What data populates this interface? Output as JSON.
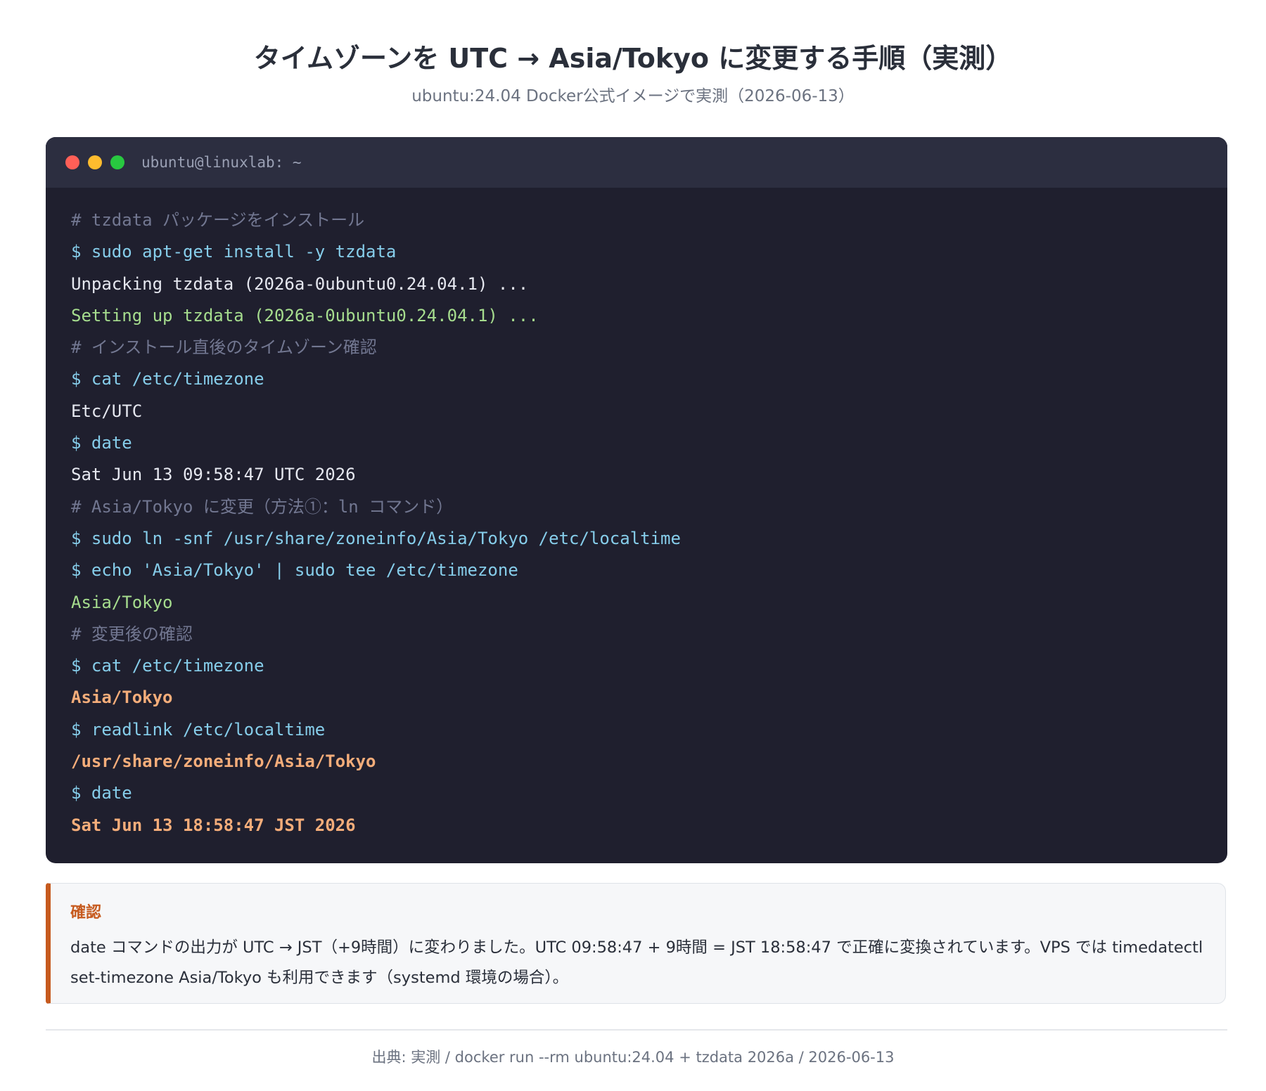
{
  "header": {
    "title": "タイムゾーンを UTC → Asia/Tokyo に変更する手順（実測）",
    "subtitle": "ubuntu:24.04 Docker公式イメージで実測（2026-06-13）"
  },
  "terminal": {
    "window_title": "ubuntu@linuxlab: ~",
    "colors": {
      "background": "#1f1f2e",
      "titlebar": "#2c2e40",
      "comment": "#727791",
      "command": "#86cdea",
      "output": "#e6e8f0",
      "success": "#a6dd8e",
      "highlight": "#f5ad7a"
    },
    "lines": [
      {
        "type": "comment",
        "text": "# tzdata パッケージをインストール"
      },
      {
        "type": "command",
        "text": "$ sudo apt-get install -y tzdata"
      },
      {
        "type": "output",
        "text": "Unpacking tzdata (2026a-0ubuntu0.24.04.1) ..."
      },
      {
        "type": "success",
        "text": "Setting up tzdata (2026a-0ubuntu0.24.04.1) ..."
      },
      {
        "type": "comment",
        "text": "# インストール直後のタイムゾーン確認"
      },
      {
        "type": "command",
        "text": "$ cat /etc/timezone"
      },
      {
        "type": "output",
        "text": "Etc/UTC"
      },
      {
        "type": "command",
        "text": "$ date"
      },
      {
        "type": "output",
        "text": "Sat Jun 13 09:58:47 UTC 2026"
      },
      {
        "type": "comment",
        "text": "# Asia/Tokyo に変更（方法①：ln コマンド）"
      },
      {
        "type": "command",
        "text": "$ sudo ln -snf /usr/share/zoneinfo/Asia/Tokyo /etc/localtime"
      },
      {
        "type": "command",
        "text": "$ echo 'Asia/Tokyo' | sudo tee /etc/timezone"
      },
      {
        "type": "success",
        "text": "Asia/Tokyo"
      },
      {
        "type": "comment",
        "text": "# 変更後の確認"
      },
      {
        "type": "command",
        "text": "$ cat /etc/timezone"
      },
      {
        "type": "highlight",
        "text": "Asia/Tokyo"
      },
      {
        "type": "command",
        "text": "$ readlink /etc/localtime"
      },
      {
        "type": "highlight",
        "text": "/usr/share/zoneinfo/Asia/Tokyo"
      },
      {
        "type": "command",
        "text": "$ date"
      },
      {
        "type": "highlight",
        "text": "Sat Jun 13 18:58:47 JST 2026"
      }
    ]
  },
  "note": {
    "title": "確認",
    "text": "date コマンドの出力が UTC → JST（+9時間）に変わりました。UTC 09:58:47 + 9時間 = JST 18:58:47 で正確に変換されています。VPS では timedatectl set-timezone Asia/Tokyo も利用できます（systemd 環境の場合）。",
    "accent_color": "#c65a1e"
  },
  "footer": {
    "text": "出典: 実測 / docker run --rm ubuntu:24.04 + tzdata 2026a / 2026-06-13"
  }
}
